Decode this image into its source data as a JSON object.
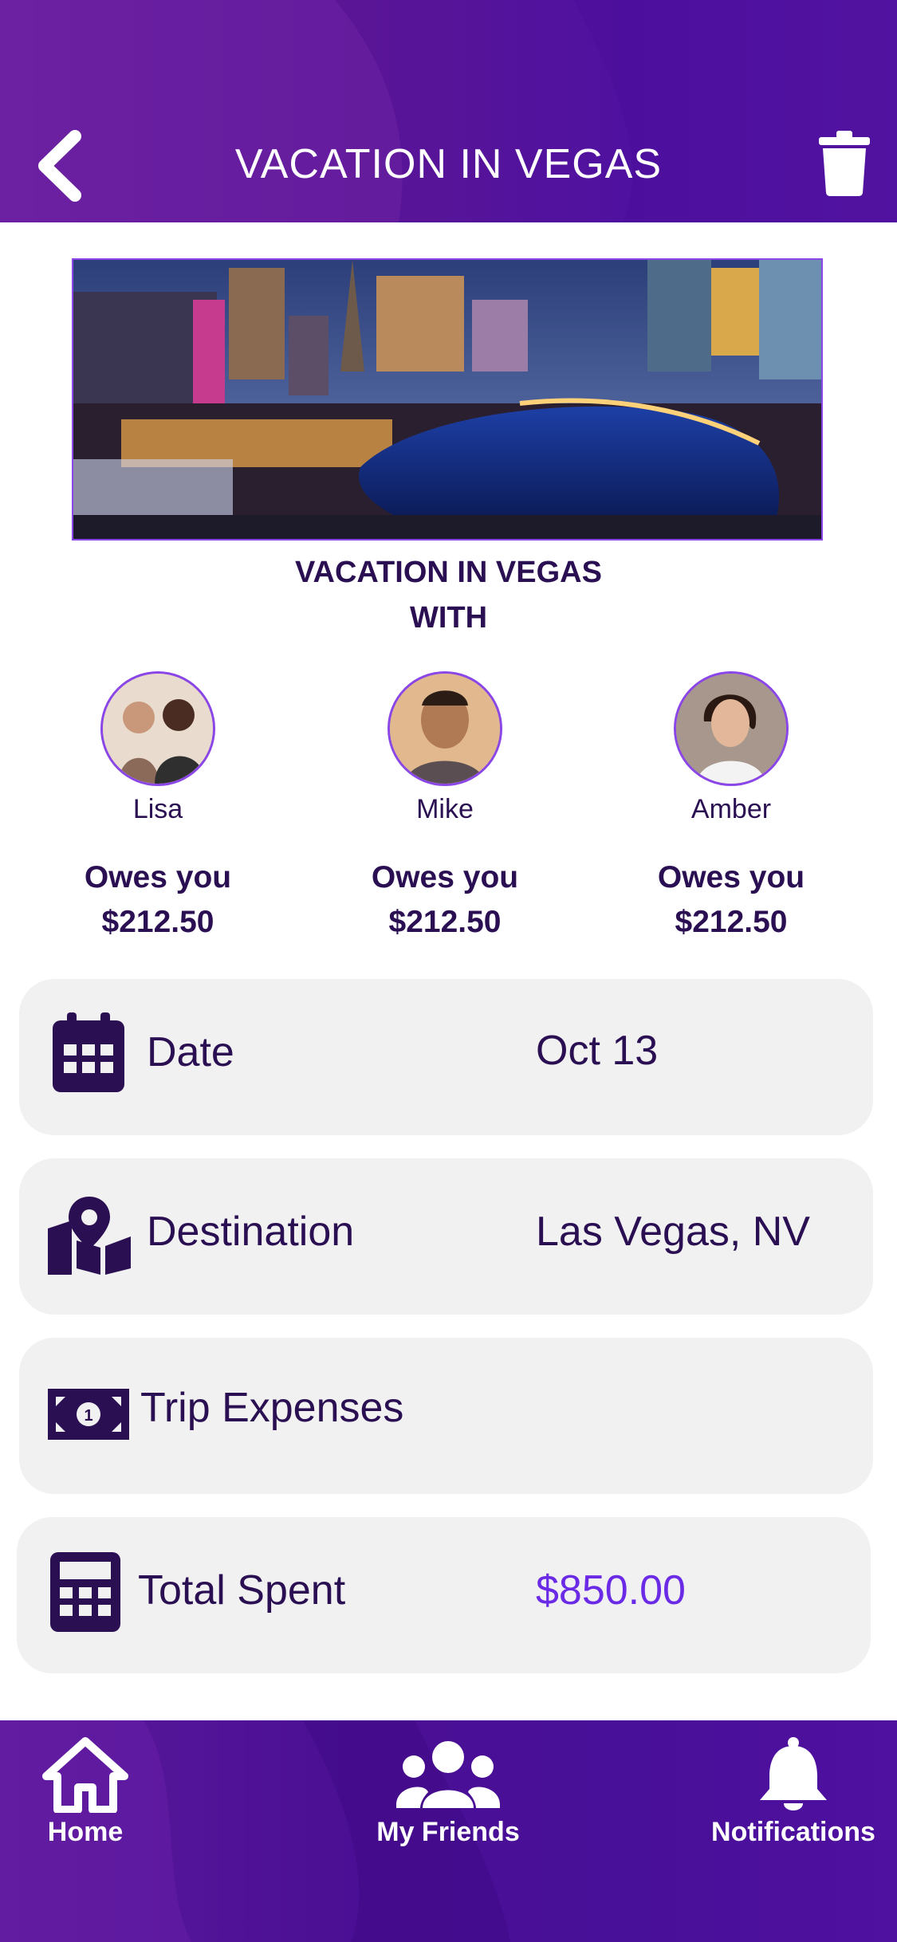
{
  "header": {
    "title": "VACATION IN VEGAS",
    "back_icon": "chevron-left-icon",
    "delete_icon": "trash-icon"
  },
  "trip": {
    "title_line1": "VACATION IN VEGAS",
    "title_line2": "WITH"
  },
  "friends": [
    {
      "name": "Lisa",
      "owes_label": "Owes you",
      "amount": "$212.50"
    },
    {
      "name": "Mike",
      "owes_label": "Owes you",
      "amount": "$212.50"
    },
    {
      "name": "Amber",
      "owes_label": "Owes you",
      "amount": "$212.50"
    }
  ],
  "details": {
    "date": {
      "label": "Date",
      "value": "Oct 13",
      "icon": "calendar-icon"
    },
    "destination": {
      "label": "Destination",
      "value": "Las Vegas, NV",
      "icon": "map-pin-icon"
    },
    "expenses": {
      "label": "Trip Expenses",
      "icon": "money-bill-icon"
    },
    "total": {
      "label": "Total Spent",
      "value": "$850.00",
      "icon": "calculator-icon"
    }
  },
  "nav": {
    "home": "Home",
    "friends": "My Friends",
    "notifications": "Notifications"
  },
  "colors": {
    "primary_purple": "#4f11a0",
    "text_dark": "#2a0f52",
    "accent": "#6a2ae6",
    "card_bg": "#f1f1f2"
  }
}
